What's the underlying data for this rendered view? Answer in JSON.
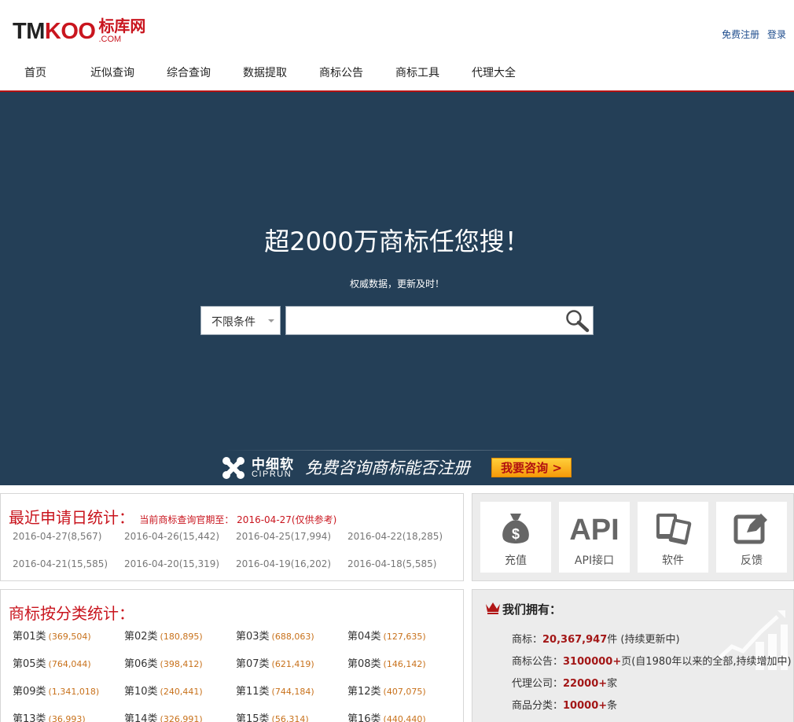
{
  "header": {
    "logo": {
      "tm": "TM",
      "koo": "KOO",
      "cn": "标库网",
      "com": ".COM"
    },
    "links": {
      "register": "免费注册",
      "login": "登录"
    },
    "nav": [
      "首页",
      "近似查询",
      "综合查询",
      "数据提取",
      "商标公告",
      "商标工具",
      "代理大全"
    ]
  },
  "hero": {
    "title": "超2000万商标任您搜！",
    "subtitle": "权威数据，更新及时！",
    "select_value": "不限条件",
    "search_placeholder": "",
    "ad": {
      "brand_cn": "中细软",
      "brand_en": "CIPRUN",
      "slogan": "免费咨询商标能否注册",
      "button": "我要咨询 >"
    }
  },
  "recent": {
    "title": "最近申请日统计：",
    "note": "当前商标查询官期至： 2016-04-27(仅供参考)",
    "dates": [
      "2016-04-27(8,567)",
      "2016-04-26(15,442)",
      "2016-04-25(17,994)",
      "2016-04-22(18,285)",
      "2016-04-21(15,585)",
      "2016-04-20(15,319)",
      "2016-04-19(16,202)",
      "2016-04-18(5,585)"
    ]
  },
  "classes": {
    "title": "商标按分类统计：",
    "items": [
      {
        "label": "第01类",
        "count": "(369,504)"
      },
      {
        "label": "第02类",
        "count": "(180,895)"
      },
      {
        "label": "第03类",
        "count": "(688,063)"
      },
      {
        "label": "第04类",
        "count": "(127,635)"
      },
      {
        "label": "第05类",
        "count": "(764,044)"
      },
      {
        "label": "第06类",
        "count": "(398,412)"
      },
      {
        "label": "第07类",
        "count": "(621,419)"
      },
      {
        "label": "第08类",
        "count": "(146,142)"
      },
      {
        "label": "第09类",
        "count": "(1,341,018)"
      },
      {
        "label": "第10类",
        "count": "(240,441)"
      },
      {
        "label": "第11类",
        "count": "(744,184)"
      },
      {
        "label": "第12类",
        "count": "(407,075)"
      },
      {
        "label": "第13类",
        "count": "(36,993)"
      },
      {
        "label": "第14类",
        "count": "(326,991)"
      },
      {
        "label": "第15类",
        "count": "(56,314)"
      },
      {
        "label": "第16类",
        "count": "(440,440)"
      }
    ]
  },
  "tools": [
    {
      "icon": "money-bag-icon",
      "label": "充值"
    },
    {
      "icon": "api-icon",
      "label": "API接口"
    },
    {
      "icon": "software-icon",
      "label": "软件"
    },
    {
      "icon": "feedback-icon",
      "label": "反馈"
    }
  ],
  "own": {
    "title": "我们拥有：",
    "rows": [
      {
        "label": "商标：",
        "value": "20,367,947",
        "suffix": "件 (持续更新中)"
      },
      {
        "label": "商标公告：",
        "value": "3100000+",
        "suffix": "页(自1980年以来的全部,持续增加中)"
      },
      {
        "label": "代理公司：",
        "value": "22000+",
        "suffix": "家"
      },
      {
        "label": "商品分类：",
        "value": "10000+",
        "suffix": "条"
      }
    ]
  },
  "colors": {
    "brand_red": "#c9151e",
    "hero_bg": "#243f57",
    "count_orange": "#c8711b"
  }
}
